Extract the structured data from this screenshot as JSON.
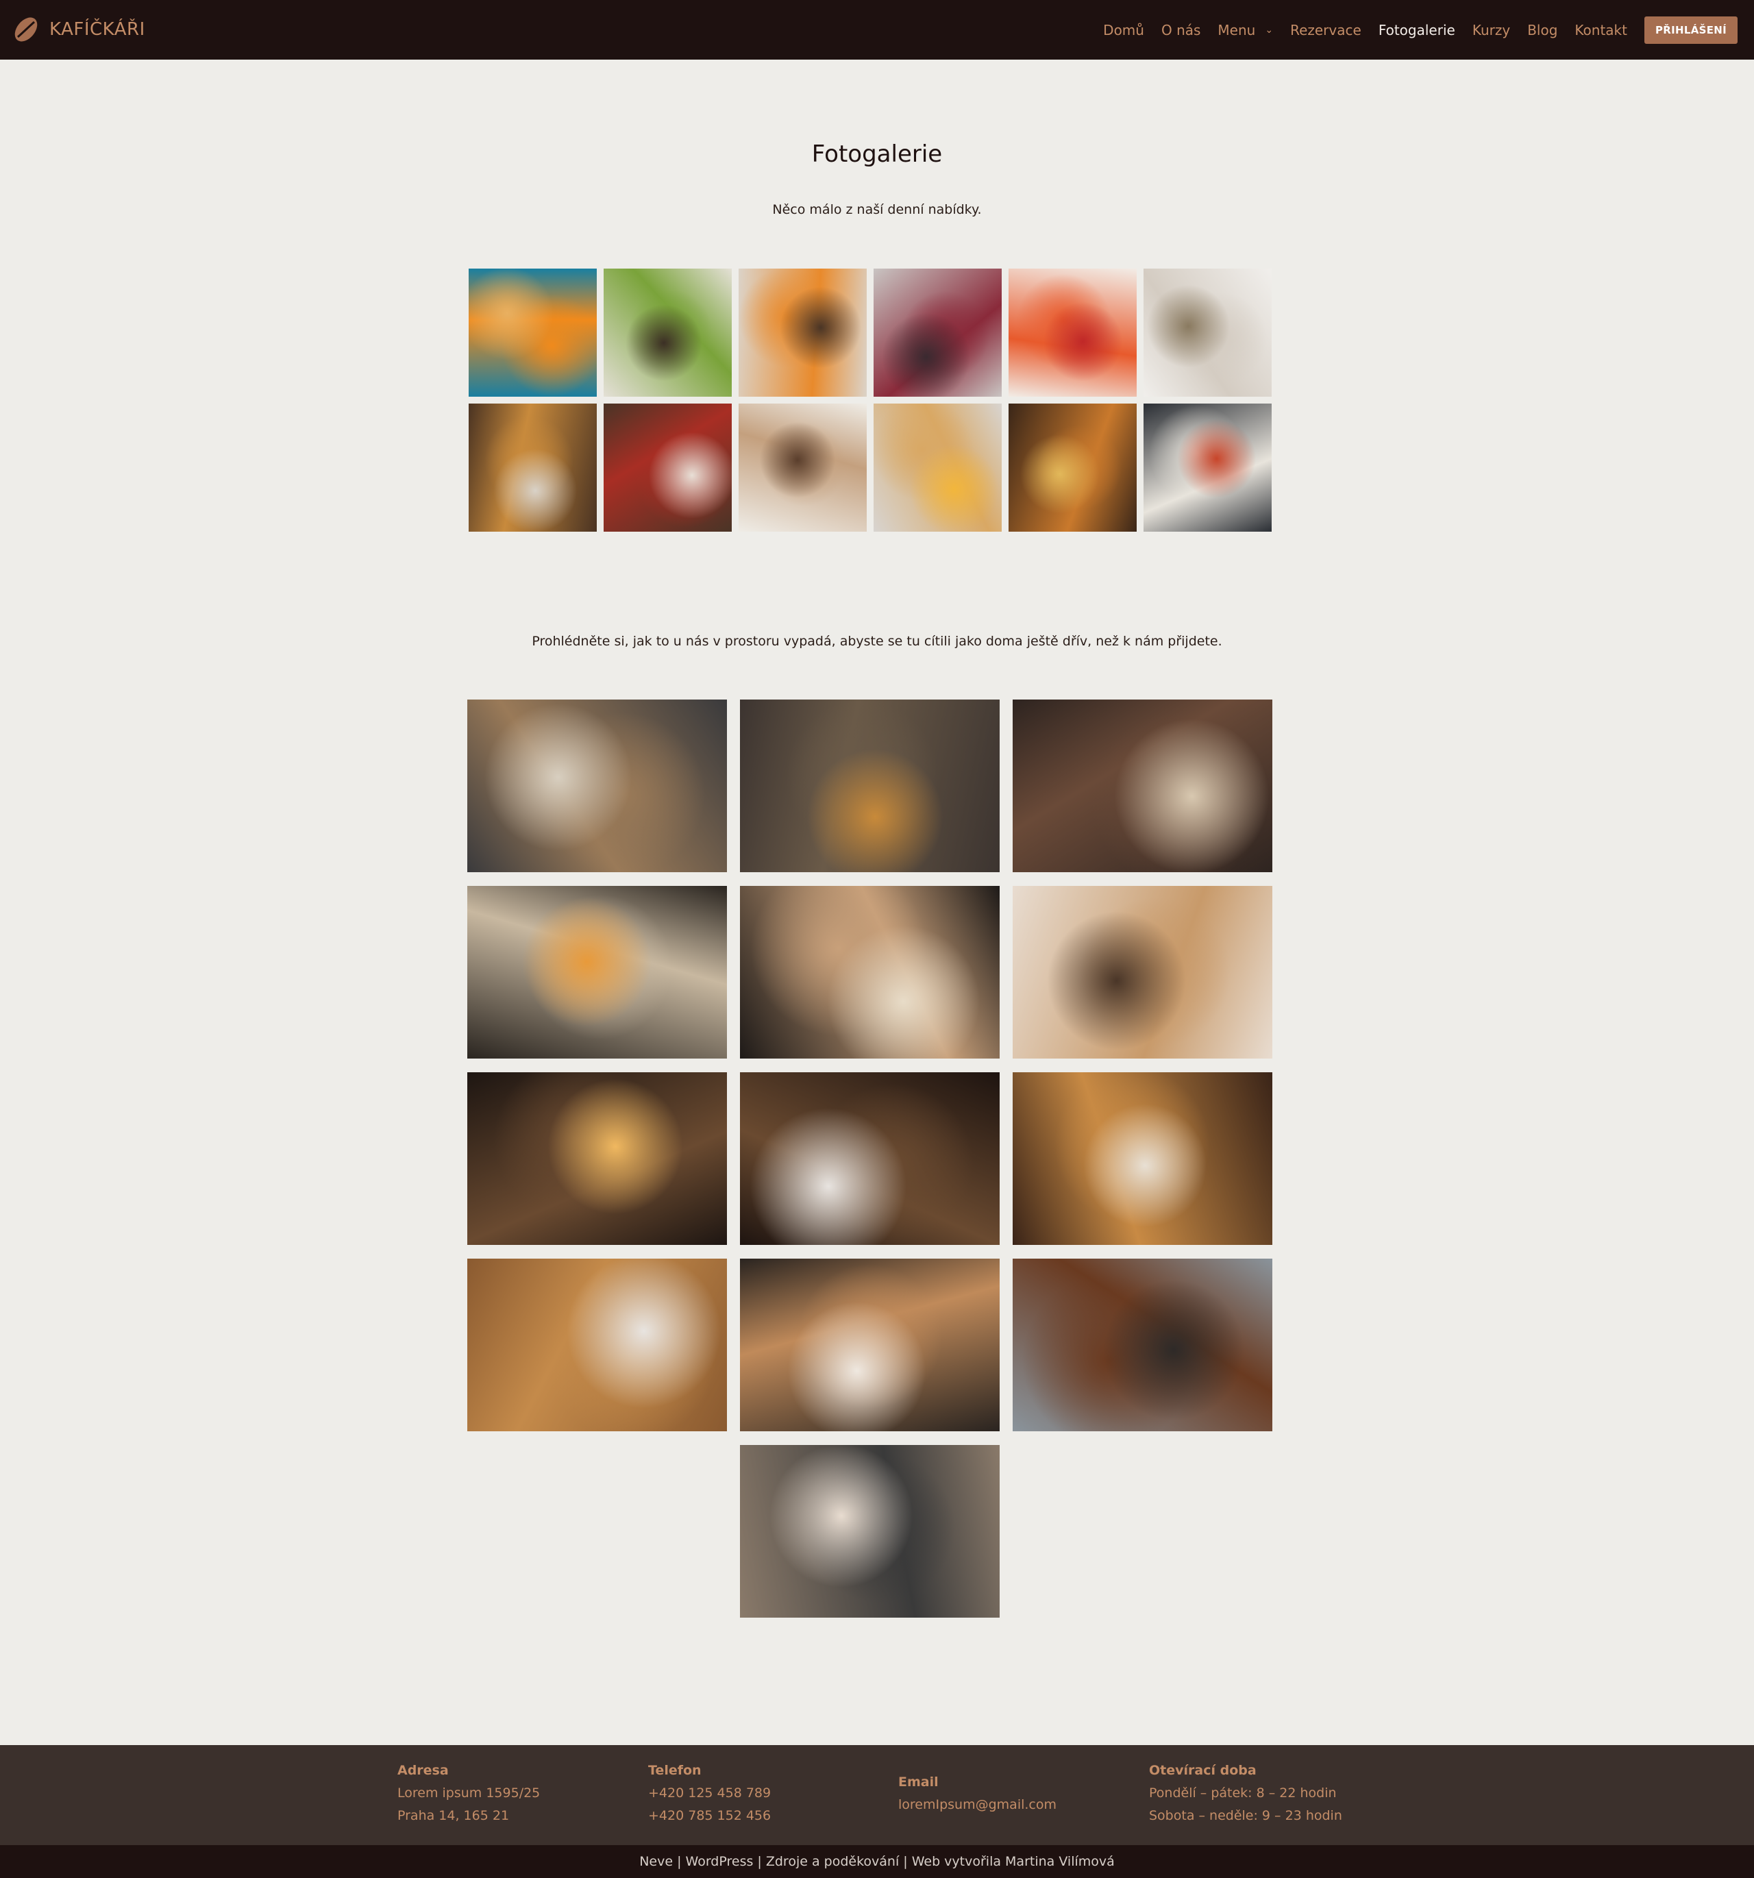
{
  "brand": {
    "name": "KAFÍČKÁŘI",
    "logo_icon": "coffee-bean-icon",
    "accent_color": "#c48d67"
  },
  "nav": {
    "items": [
      {
        "label": "Domů",
        "active": false
      },
      {
        "label": "O nás",
        "active": false
      },
      {
        "label": "Menu",
        "active": false,
        "has_dropdown": true
      },
      {
        "label": "Rezervace",
        "active": false
      },
      {
        "label": "Fotogalerie",
        "active": true
      },
      {
        "label": "Kurzy",
        "active": false
      },
      {
        "label": "Blog",
        "active": false
      },
      {
        "label": "Kontakt",
        "active": false
      }
    ],
    "login_label": "PŘIHLÁŠENÍ"
  },
  "page": {
    "title": "Fotogalerie",
    "intro": "Něco málo z naší denní nabídky.",
    "intro2": "Prohlédněte si, jak to u nás v prostoru vypadá, abyste se tu cítili jako doma ještě dřív, než k nám přijdete."
  },
  "gallery_small": [
    {
      "name": "orange-juice-photo",
      "colors": [
        "#1a7fa0",
        "#f08a1c",
        "#e9b060"
      ]
    },
    {
      "name": "green-smoothie-photo",
      "colors": [
        "#e4e0d6",
        "#7aa33a",
        "#3c2f25"
      ]
    },
    {
      "name": "orange-drink-photo",
      "colors": [
        "#dcd3c8",
        "#e88a2c",
        "#4a3526"
      ]
    },
    {
      "name": "berry-smoothie-photo",
      "colors": [
        "#c9c4c2",
        "#8a2a3a",
        "#3a2a30"
      ]
    },
    {
      "name": "strawberry-lemonade-photo",
      "colors": [
        "#f2ece6",
        "#e85a2c",
        "#c02828"
      ]
    },
    {
      "name": "flower-tea-photo",
      "colors": [
        "#f1efec",
        "#d4ccc2",
        "#8a7a60"
      ]
    },
    {
      "name": "tea-press-photo",
      "colors": [
        "#4a3322",
        "#c88a3c",
        "#d9d2c8"
      ]
    },
    {
      "name": "turkish-tea-photo",
      "colors": [
        "#4a3426",
        "#a82e24",
        "#e8dfd6"
      ]
    },
    {
      "name": "iced-coffee-photo",
      "colors": [
        "#efece6",
        "#c4a07e",
        "#5a3e2c"
      ]
    },
    {
      "name": "breakfast-toast-photo",
      "colors": [
        "#d8d4d0",
        "#d9a864",
        "#f2b63c"
      ]
    },
    {
      "name": "breakfast-table-photo",
      "colors": [
        "#3a2618",
        "#c9792c",
        "#e2b85a"
      ]
    },
    {
      "name": "english-breakfast-photo",
      "colors": [
        "#2a2e34",
        "#e8e4dc",
        "#c8452a"
      ]
    }
  ],
  "gallery_large": [
    {
      "name": "busy-cafe-photo",
      "colors": [
        "#3a3a3c",
        "#9a7a58",
        "#d8cfc0"
      ]
    },
    {
      "name": "woman-at-window-photo",
      "colors": [
        "#3c3430",
        "#6a5a48",
        "#c88a3a"
      ]
    },
    {
      "name": "cafe-interior-photo",
      "colors": [
        "#2e2420",
        "#6a4a38",
        "#d8c8b0"
      ]
    },
    {
      "name": "espresso-machine-photo",
      "colors": [
        "#2a2520",
        "#c8b8a0",
        "#e89a3a"
      ]
    },
    {
      "name": "bread-shelf-photo",
      "colors": [
        "#1e1a18",
        "#c8a07a",
        "#e8dcc8"
      ]
    },
    {
      "name": "friends-sunset-photo",
      "colors": [
        "#e8dcd0",
        "#c89a6a",
        "#4a3628"
      ]
    },
    {
      "name": "edison-bulbs-photo",
      "colors": [
        "#1e1612",
        "#6a4a30",
        "#f0b860"
      ]
    },
    {
      "name": "coffee-cup-beans-photo",
      "colors": [
        "#1e1410",
        "#6a4a30",
        "#e8e4e0"
      ]
    },
    {
      "name": "latte-art-cup-photo",
      "colors": [
        "#3a2418",
        "#c88a44",
        "#e8e0d4"
      ]
    },
    {
      "name": "coffee-cups-table-photo",
      "colors": [
        "#8a5a30",
        "#c48a4a",
        "#e8e4e0"
      ]
    },
    {
      "name": "latte-toast-photo",
      "colors": [
        "#2a2420",
        "#c08a5a",
        "#efe8e0"
      ]
    },
    {
      "name": "portafilter-photo",
      "colors": [
        "#8a949c",
        "#6a3a20",
        "#2e2a28"
      ]
    },
    {
      "name": "milk-pouring-photo",
      "colors": [
        "#8a7a6a",
        "#3a3a3a",
        "#e8dcd0"
      ]
    }
  ],
  "footer": {
    "address": {
      "heading": "Adresa",
      "lines": [
        "Lorem ipsum 1595/25",
        "Praha 14, 165 21"
      ]
    },
    "phone": {
      "heading": "Telefon",
      "lines": [
        "+420 125 458 789",
        "+420 785 152 456"
      ]
    },
    "email": {
      "heading": "Email",
      "lines": [
        "loremIpsum@gmail.com"
      ]
    },
    "hours": {
      "heading": "Otevírací doba",
      "lines": [
        "Pondělí – pátek: 8 – 22 hodin",
        "Sobota – neděle: 9 – 23 hodin"
      ]
    },
    "copyright": "Neve | WordPress | Zdroje a poděkování | Web vytvořila Martina Vilímová"
  }
}
